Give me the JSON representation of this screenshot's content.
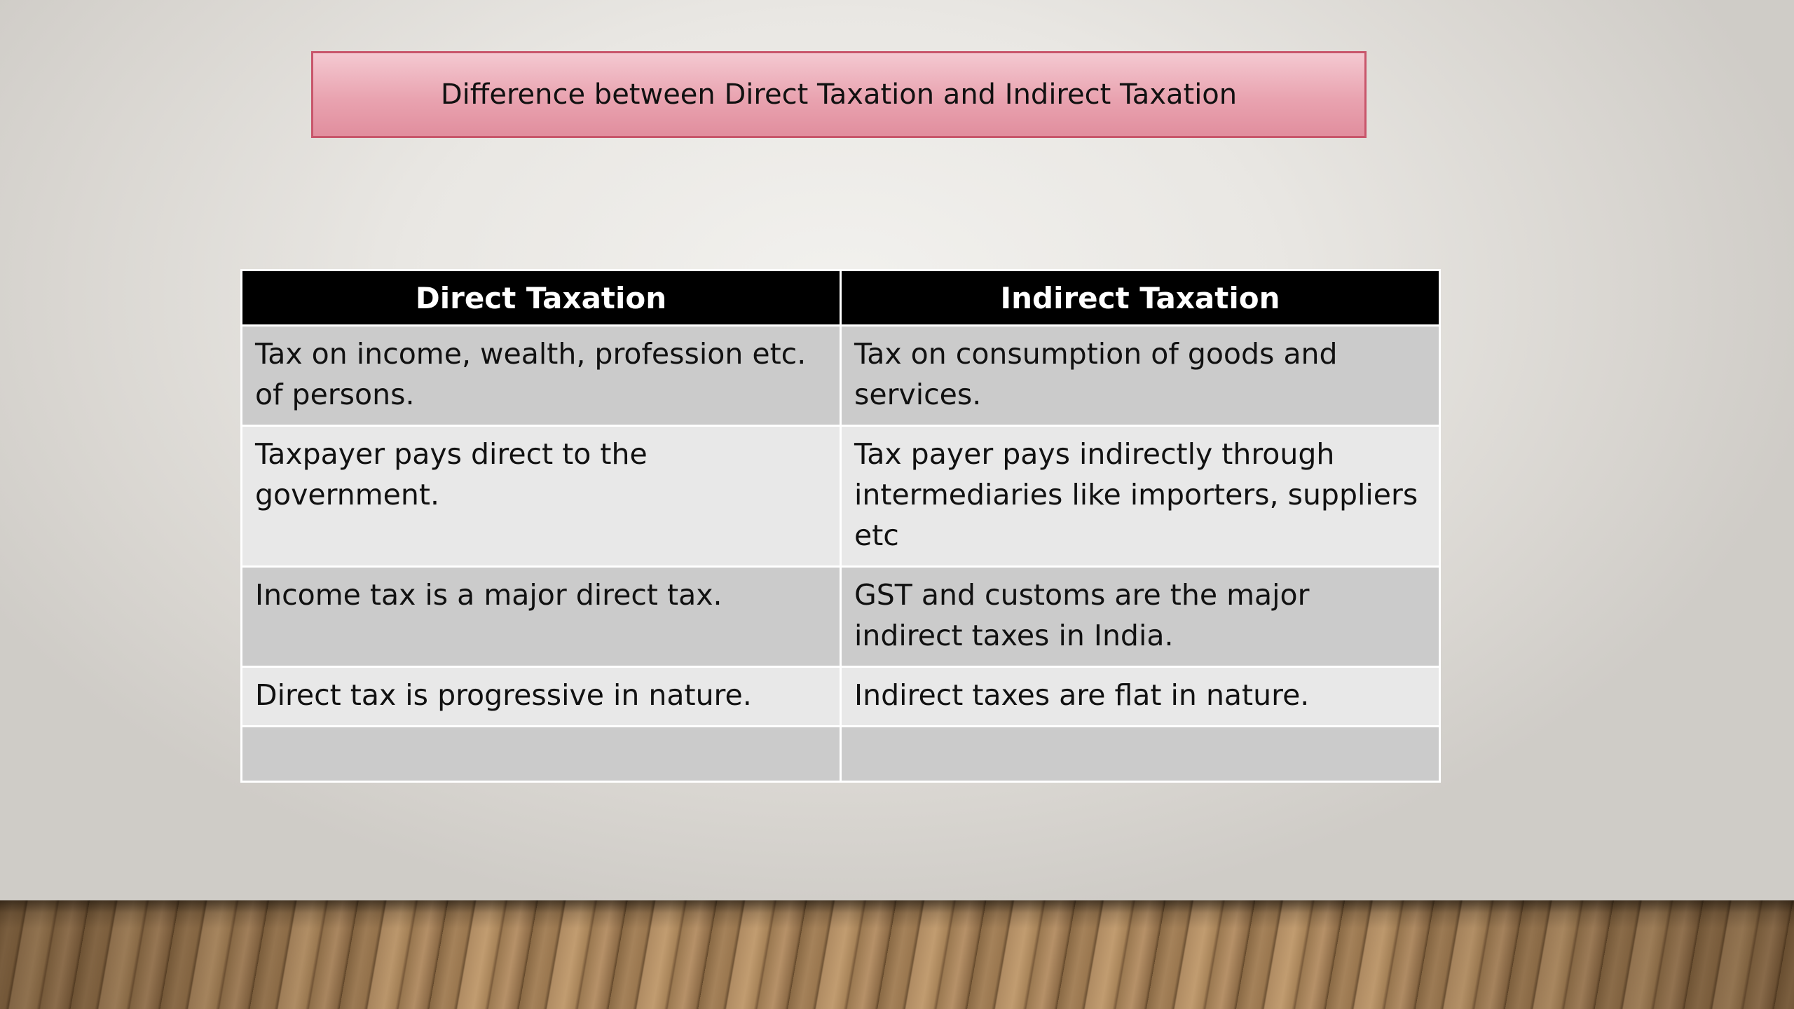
{
  "title": "Difference between Direct Taxation and Indirect Taxation",
  "table": {
    "headers": [
      "Direct Taxation",
      "Indirect Taxation"
    ],
    "rows": [
      [
        "Tax on income, wealth, profession etc. of persons.",
        "Tax on consumption of goods and services."
      ],
      [
        "Taxpayer pays direct to the government.",
        "Tax payer pays indirectly through intermediaries like importers, suppliers etc"
      ],
      [
        "Income tax is a major direct tax.",
        "GST and customs are the major indirect taxes in India."
      ],
      [
        "Direct tax is progressive in nature.",
        "Indirect taxes are flat in nature."
      ],
      [
        "",
        ""
      ]
    ]
  },
  "colors": {
    "title_fill": "#e9a3b0",
    "title_border": "#c8566b",
    "header_fill": "#000000",
    "row_dark": "#cbcbcb",
    "row_light": "#e8e8e8"
  }
}
